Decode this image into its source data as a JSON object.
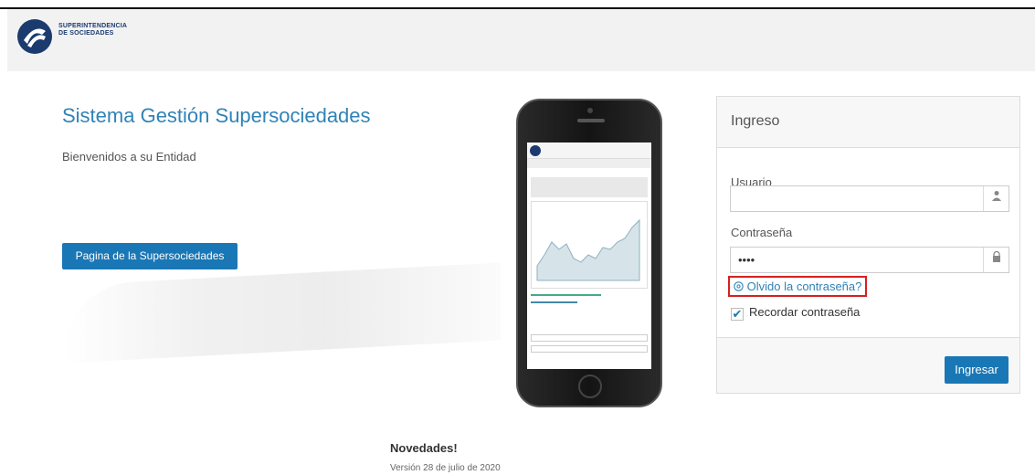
{
  "header": {
    "logo_line1": "SUPERINTENDENCIA",
    "logo_line2": "DE SOCIEDADES"
  },
  "main": {
    "title": "Sistema Gestión Supersociedades",
    "welcome": "Bienvenidos a su Entidad",
    "site_button": "Pagina de la Supersociedades"
  },
  "login": {
    "heading": "Ingreso",
    "user_label": "Usuario",
    "user_value": "",
    "password_label": "Contraseña",
    "password_value": "••••",
    "forgot_link": "Olvido la contraseña?",
    "remember_label": "Recordar contraseña",
    "remember_checked": true,
    "submit": "Ingresar"
  },
  "news": {
    "title": "Novedades!",
    "version": "Versión 28 de julio de 2020"
  },
  "colors": {
    "accent": "#1a77b5",
    "title_blue": "#2f83b7",
    "highlight_red": "#d62020"
  },
  "icons": {
    "user": "user-icon",
    "lock": "lock-icon",
    "forgot": "help-circle-icon",
    "check": "checkmark-icon"
  }
}
